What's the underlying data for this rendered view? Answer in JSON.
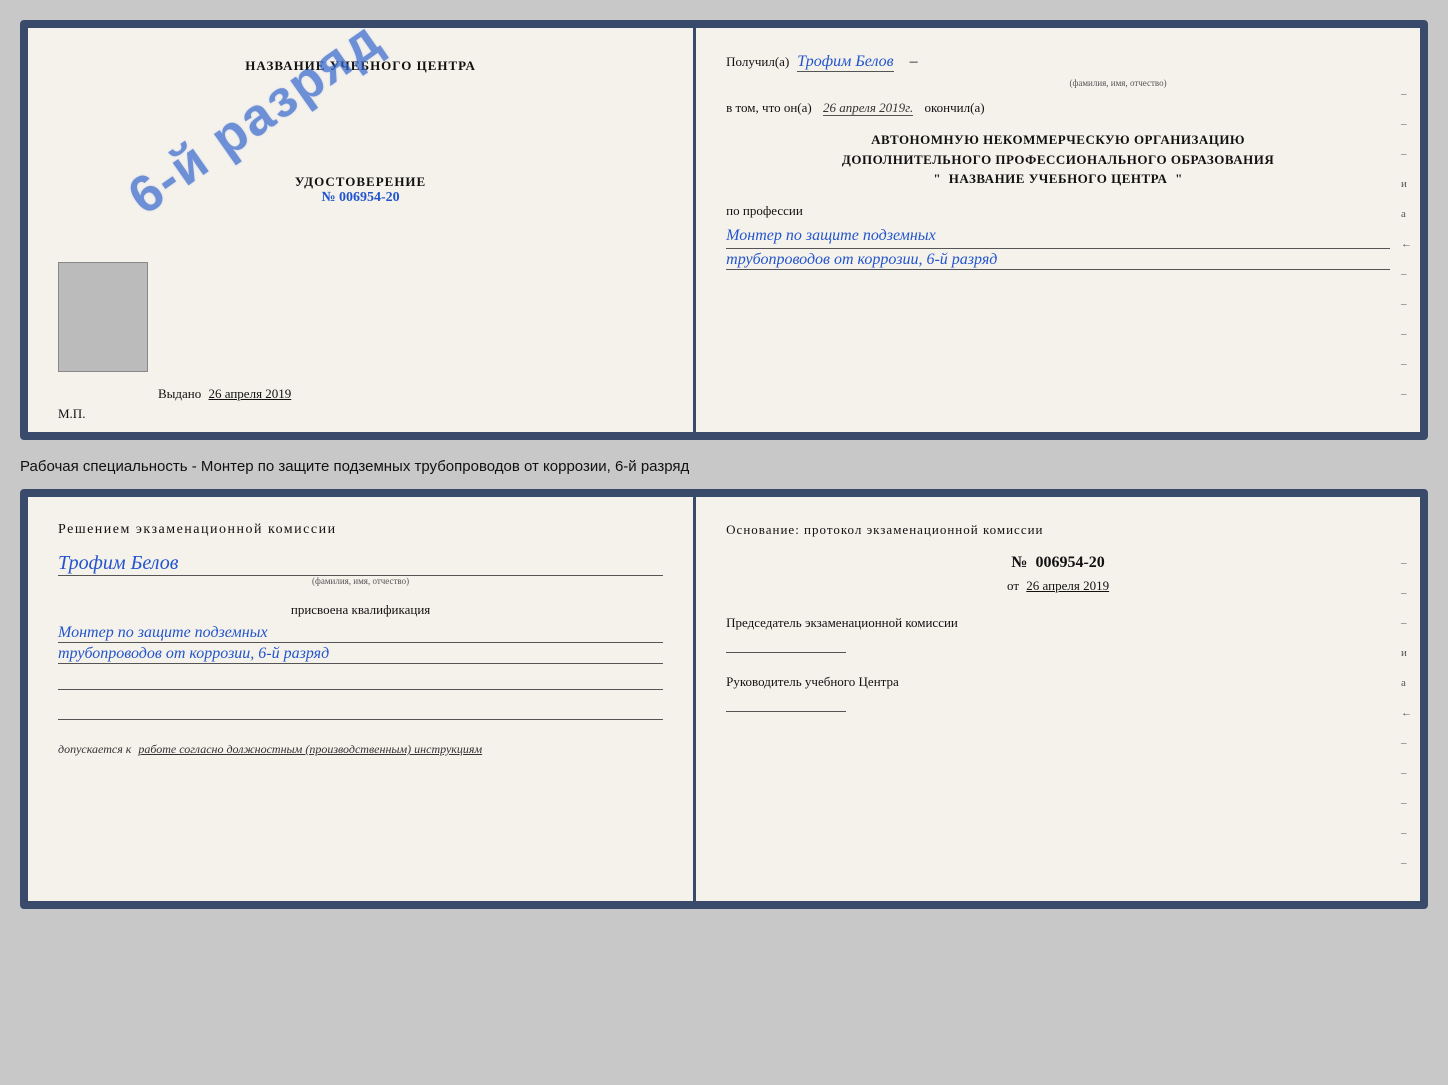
{
  "topCert": {
    "leftSide": {
      "title": "НАЗВАНИЕ УЧЕБНОГО ЦЕНТРА",
      "stamp": "6-й разряд",
      "udostovTitle": "УДОСТОВЕРЕНИЕ",
      "numLabel": "№",
      "numValue": "006954-20",
      "vydanoLabel": "Выдано",
      "vydanoDate": "26 апреля 2019",
      "mpLabel": "М.П."
    },
    "rightSide": {
      "poluchilLabel": "Получил(а)",
      "nameHandwritten": "Трофим Белов",
      "nameSublabel": "(фамилия, имя, отчество)",
      "dashAfterName": "–",
      "vTomChtoLabel": "в том, что он(а)",
      "dateFilled": "26 апреля 2019г.",
      "okonchilLabel": "окончил(а)",
      "orgLine1": "АВТОНОМНУЮ НЕКОММЕРЧЕСКУЮ ОРГАНИЗАЦИЮ",
      "orgLine2": "ДОПОЛНИТЕЛЬНОГО ПРОФЕССИОНАЛЬНОГО ОБРАЗОВАНИЯ",
      "orgQuote1": "\"",
      "orgCenterName": "НАЗВАНИЕ УЧЕБНОГО ЦЕНТРА",
      "orgQuote2": "\"",
      "poProf": "по профессии",
      "profLine1": "Монтер по защите подземных",
      "profLine2": "трубопроводов от коррозии, 6-й разряд",
      "rightMarkers": [
        "-",
        "-",
        "-",
        "и",
        "а",
        "←",
        "-",
        "-",
        "-",
        "-",
        "-"
      ]
    }
  },
  "specialtyText": "Рабочая специальность - Монтер по защите подземных трубопроводов от коррозии, 6-й разряд",
  "bottomCert": {
    "leftSide": {
      "resheniemTitle": "Решением экзаменационной комиссии",
      "nameHandwritten": "Трофим Белов",
      "nameSublabel": "(фамилия, имя, отчество)",
      "prisvoenaLabel": "присвоена квалификация",
      "kvalLine1": "Монтер по защите подземных",
      "kvalLine2": "трубопроводов от коррозии, 6-й разряд",
      "dopuskaetsyaLabel": "допускается к",
      "dopuskaetsyaFilled": "работе согласно должностным (производственным) инструкциям"
    },
    "rightSide": {
      "osnovanieLine": "Основание: протокол экзаменационной комиссии",
      "numLabel": "№",
      "numValue": "006954-20",
      "otLabel": "от",
      "otDate": "26 апреля 2019",
      "predsedatelTitle": "Председатель экзаменационной комиссии",
      "rukovoditelTitle": "Руководитель учебного Центра",
      "rightMarkers": [
        "-",
        "-",
        "-",
        "и",
        "а",
        "←",
        "-",
        "-",
        "-",
        "-",
        "-"
      ]
    }
  }
}
